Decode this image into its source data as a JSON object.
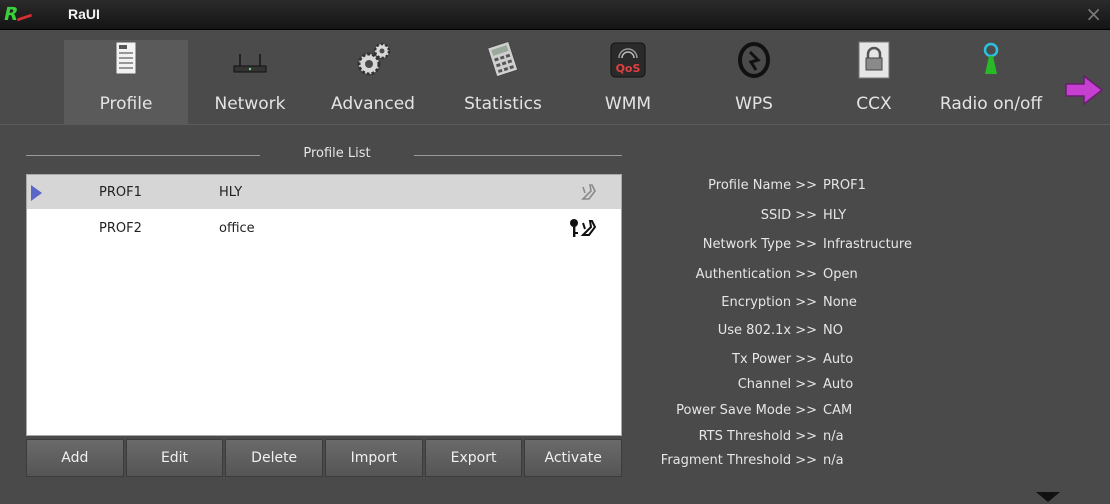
{
  "window": {
    "title": "RaUI",
    "logo_text": "R",
    "close_glyph": "×"
  },
  "toolbar": {
    "items": [
      {
        "label": "Profile",
        "icon": "notepad-icon"
      },
      {
        "label": "Network",
        "icon": "router-icon"
      },
      {
        "label": "Advanced",
        "icon": "gears-icon"
      },
      {
        "label": "Statistics",
        "icon": "calculator-icon"
      },
      {
        "label": "WMM",
        "icon": "qos-icon"
      },
      {
        "label": "WPS",
        "icon": "wps-icon"
      },
      {
        "label": "CCX",
        "icon": "ccx-lock-icon"
      },
      {
        "label": "Radio on/off",
        "icon": "antenna-icon"
      }
    ],
    "next_icon": "arrow-right-icon"
  },
  "profile_list": {
    "title": "Profile List",
    "rows": [
      {
        "name": "PROF1",
        "ssid": "HLY",
        "selected": true,
        "secured": false
      },
      {
        "name": "PROF2",
        "ssid": "office",
        "selected": false,
        "secured": true
      }
    ]
  },
  "buttons": {
    "add": "Add",
    "edit": "Edit",
    "delete": "Delete",
    "import": "Import",
    "export": "Export",
    "activate": "Activate"
  },
  "details": [
    {
      "key": "Profile Name >>",
      "value": "PROF1"
    },
    {
      "key": "SSID >>",
      "value": "HLY"
    },
    {
      "key": "Network Type >>",
      "value": "Infrastructure"
    },
    {
      "key": "Authentication >>",
      "value": "Open"
    },
    {
      "key": "Encryption >>",
      "value": "None"
    },
    {
      "key": "Use 802.1x >>",
      "value": "NO"
    },
    {
      "key": "Tx Power >>",
      "value": "Auto"
    },
    {
      "key": "Channel >>",
      "value": "Auto"
    },
    {
      "key": "Power Save Mode >>",
      "value": "CAM"
    },
    {
      "key": "RTS Threshold >>",
      "value": "n/a"
    },
    {
      "key": "Fragment Threshold >>",
      "value": "n/a"
    }
  ],
  "colors": {
    "background": "#4a4a4a",
    "selected_row": "#d6d6d6",
    "selection_arrow": "#5a66c8",
    "logo": "#3ad23a"
  }
}
